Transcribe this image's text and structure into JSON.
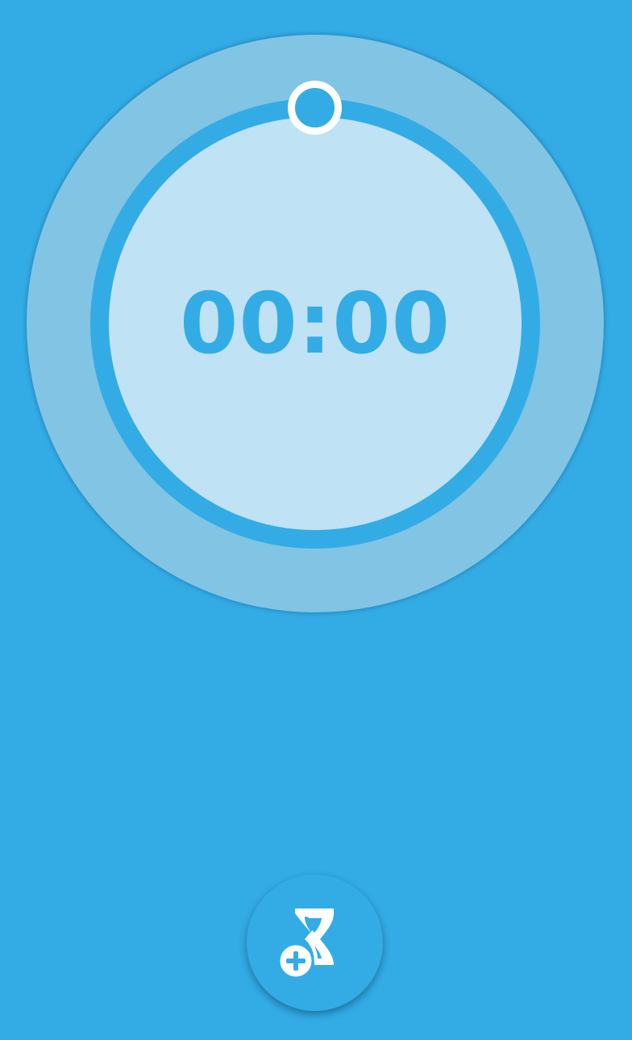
{
  "timer": {
    "display": "00:00",
    "progress": 0
  },
  "actions": {
    "add_timer_icon": "hourglass-add-icon"
  },
  "colors": {
    "background": "#33ace6",
    "outer_ring": "#82c4e4",
    "face": "#bfe2f4",
    "accent": "#33ace6",
    "handle": "#ffffff"
  }
}
